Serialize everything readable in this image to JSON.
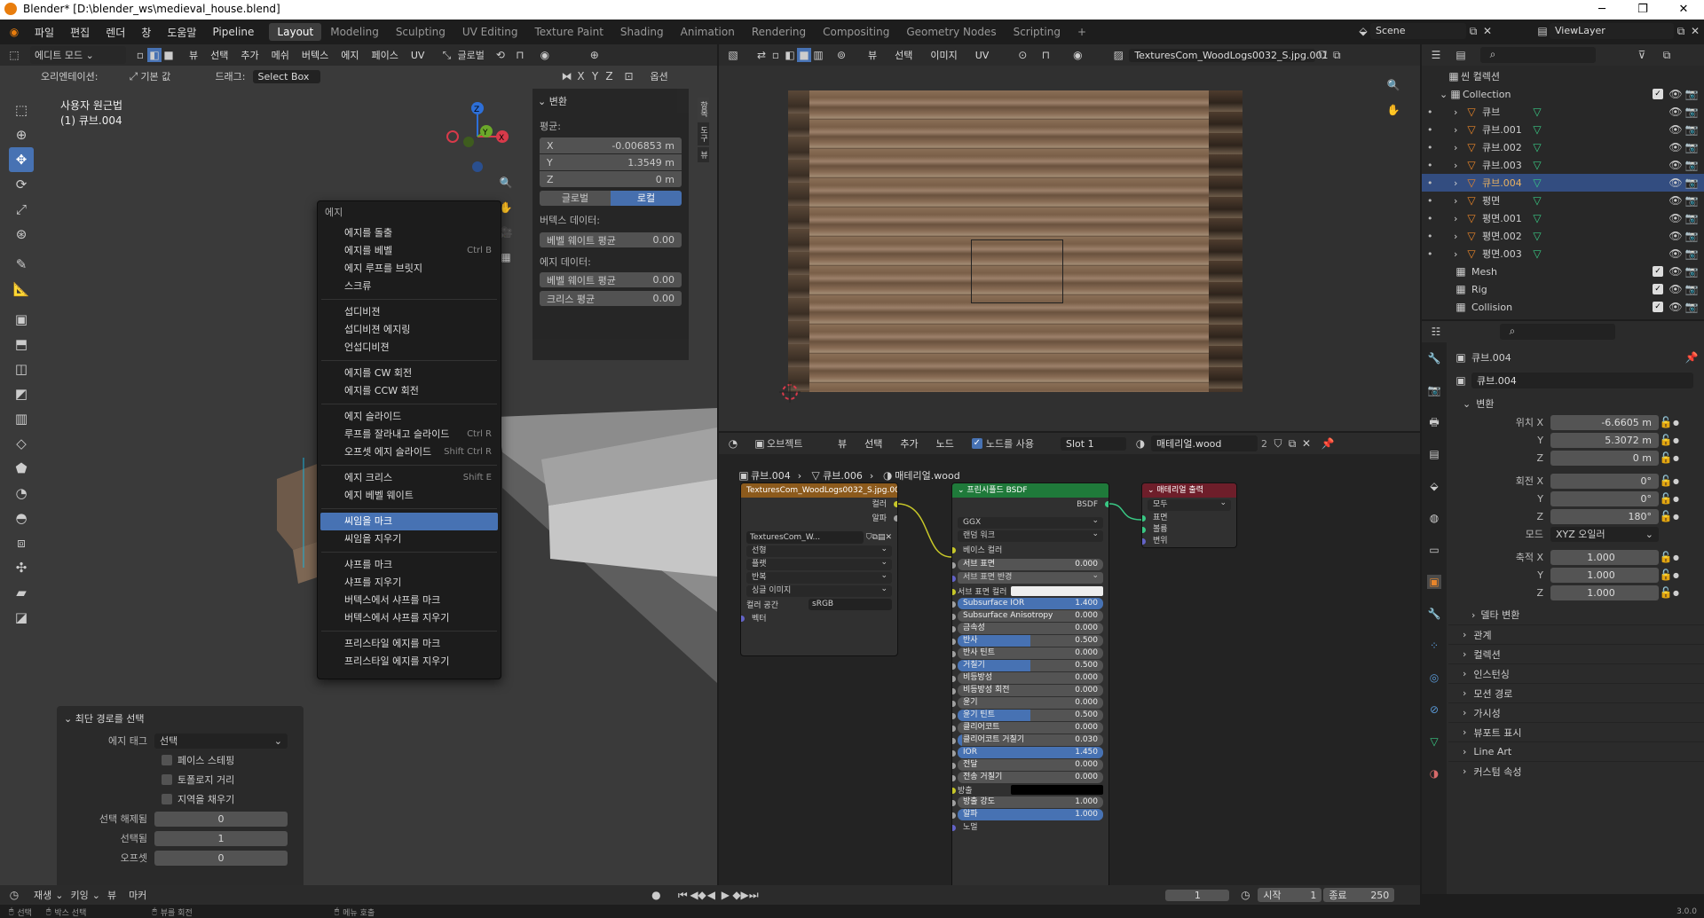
{
  "window": {
    "title": "Blender* [D:\\blender_ws\\medieval_house.blend]",
    "min": "─",
    "max": "❐",
    "close": "✕"
  },
  "menus": [
    "파일",
    "편집",
    "렌더",
    "창",
    "도움말",
    "Pipeline"
  ],
  "workspaces": [
    "Layout",
    "Modeling",
    "Sculpting",
    "UV Editing",
    "Texture Paint",
    "Shading",
    "Animation",
    "Rendering",
    "Compositing",
    "Geometry Nodes",
    "Scripting",
    "+"
  ],
  "scene": {
    "name": "Scene",
    "view_layer": "ViewLayer"
  },
  "viewport3d": {
    "mode": "에디트 모드",
    "menu": [
      "뷰",
      "선택",
      "추가",
      "메쉬",
      "버텍스",
      "에지",
      "페이스",
      "UV"
    ],
    "orientation_label": "오리엔테이션:",
    "orientation_value": "기본 값",
    "drag_label": "드래그:",
    "drag_value": "Select Box",
    "transform_orient": "글로벌",
    "options": "옵션",
    "overlay_title": "사용자 원근법",
    "overlay_obj": "(1) 큐브.004",
    "axes": {
      "x": "X",
      "y": "Y",
      "z": "Z"
    }
  },
  "npanel": {
    "header": "변환",
    "median": "평균:",
    "x_label": "X",
    "x": "-0.006853 m",
    "y_label": "Y",
    "y": "1.3549 m",
    "z_label": "Z",
    "z": "0 m",
    "global": "글로벌",
    "local": "로컬",
    "vertex_data": "버텍스 데이터:",
    "bevel_weight_v": "베벨 웨이트 평균",
    "bevel_weight_v_val": "0.00",
    "edge_data": "에지 데이터:",
    "bevel_weight_e": "베벨 웨이트 평균",
    "bevel_weight_e_val": "0.00",
    "crease": "크리스 평균",
    "crease_val": "0.00",
    "tabs": [
      "항목",
      "도구",
      "뷰"
    ]
  },
  "context_menu": {
    "title": "에지",
    "groups": [
      [
        {
          "l": "에지를 돌출",
          "s": ""
        },
        {
          "l": "에지를 베벨",
          "s": "Ctrl B"
        },
        {
          "l": "에지 루프를 브릿지",
          "s": ""
        },
        {
          "l": "스크류",
          "s": ""
        }
      ],
      [
        {
          "l": "섭디비젼",
          "s": ""
        },
        {
          "l": "섭디비젼 에지링",
          "s": ""
        },
        {
          "l": "언섭디비젼",
          "s": ""
        }
      ],
      [
        {
          "l": "에지를 CW 회전",
          "s": ""
        },
        {
          "l": "에지를 CCW 회전",
          "s": ""
        }
      ],
      [
        {
          "l": "에지 슬라이드",
          "s": ""
        },
        {
          "l": "루프를 잘라내고 슬라이드",
          "s": "Ctrl R"
        },
        {
          "l": "오프셋 에지 슬라이드",
          "s": "Shift Ctrl R"
        }
      ],
      [
        {
          "l": "에지 크리스",
          "s": "Shift E"
        },
        {
          "l": "에지 베벨 웨이트",
          "s": ""
        }
      ],
      [
        {
          "l": "씨임을 마크",
          "s": "",
          "sel": true
        },
        {
          "l": "씨임을 지우기",
          "s": ""
        }
      ],
      [
        {
          "l": "샤프를 마크",
          "s": ""
        },
        {
          "l": "샤프를 지우기",
          "s": ""
        },
        {
          "l": "버텍스에서 샤프를 마크",
          "s": ""
        },
        {
          "l": "버텍스에서 샤프를 지우기",
          "s": ""
        }
      ],
      [
        {
          "l": "프리스타일 에지를 마크",
          "s": ""
        },
        {
          "l": "프리스타일 에지를 지우기",
          "s": ""
        }
      ]
    ]
  },
  "operator_panel": {
    "title": "최단 경로를 선택",
    "edge_tag_label": "에지 태그",
    "edge_tag": "선택",
    "face_stepping": "페이스 스테핑",
    "topology_distance": "토폴로지 거리",
    "fill_region": "지역을 채우기",
    "deselected_label": "선택 해제됨",
    "deselected": "0",
    "selected_label": "선택됨",
    "selected": "1",
    "offset_label": "오프셋",
    "offset": "0"
  },
  "timeline": {
    "playback": "재생",
    "keying": "키잉",
    "view": "뷰",
    "marker": "마커",
    "current": "1",
    "start_label": "시작",
    "start": "1",
    "end_label": "종료",
    "end": "250"
  },
  "statusbar": {
    "a": "선택",
    "b": "박스 선택",
    "c": "뷰를 회전",
    "d": "메뉴 호출",
    "version": "3.0.0"
  },
  "image_editor": {
    "menu": [
      "뷰",
      "선택",
      "이미지",
      "UV"
    ],
    "image": "TexturesCom_WoodLogs0032_S.jpg.001"
  },
  "node_editor": {
    "type": "오브젝트",
    "menu": [
      "뷰",
      "선택",
      "추가",
      "노드"
    ],
    "use_nodes": "노드를 사용",
    "slot": "Slot 1",
    "material": "매테리얼.wood",
    "users": "2",
    "breadcrumb": [
      "큐브.004",
      "큐브.006",
      "매테리얼.wood"
    ],
    "tex_node": {
      "title": "TexturesCom_WoodLogs0032_S.jpg.00",
      "out_color": "컬러",
      "out_alpha": "알파",
      "img": "TexturesCom_W...",
      "interp": "선형",
      "proj": "플랫",
      "ext": "반복",
      "src": "싱글 이미지",
      "cs_label": "컬러 공간",
      "cs": "sRGB",
      "vector": "벡터"
    },
    "bsdf": {
      "title": "프린시플드 BSDF",
      "out": "BSDF",
      "dist": "GGX",
      "sss": "랜덤 워크",
      "base_color": "베이스 컬러",
      "sliders": [
        {
          "l": "서브 표면",
          "v": "0.000",
          "f": 0
        },
        {
          "l": "서브 표면 반경",
          "v": "",
          "f": 0,
          "dd": true
        },
        {
          "l": "서브 표면 컬러",
          "v": "",
          "f": 0,
          "white": true
        },
        {
          "l": "Subsurface IOR",
          "v": "1.400",
          "f": 1
        },
        {
          "l": "Subsurface Anisotropy",
          "v": "0.000",
          "f": 0
        },
        {
          "l": "금속성",
          "v": "0.000",
          "f": 0
        },
        {
          "l": "반사",
          "v": "0.500",
          "f": 0.5
        },
        {
          "l": "반사 틴트",
          "v": "0.000",
          "f": 0
        },
        {
          "l": "거칠기",
          "v": "0.500",
          "f": 0.5
        },
        {
          "l": "비등방성",
          "v": "0.000",
          "f": 0
        },
        {
          "l": "비등방성 회전",
          "v": "0.000",
          "f": 0
        },
        {
          "l": "윤기",
          "v": "0.000",
          "f": 0
        },
        {
          "l": "윤기 틴트",
          "v": "0.500",
          "f": 0.5
        },
        {
          "l": "클리어코트",
          "v": "0.000",
          "f": 0
        },
        {
          "l": "클리어코트 거칠기",
          "v": "0.030",
          "f": 0.03
        },
        {
          "l": "IOR",
          "v": "1.450",
          "f": 1
        },
        {
          "l": "전달",
          "v": "0.000",
          "f": 0
        },
        {
          "l": "전송 거칠기",
          "v": "0.000",
          "f": 0
        },
        {
          "l": "방출",
          "v": "",
          "f": 0,
          "black": true
        },
        {
          "l": "방출 강도",
          "v": "1.000",
          "f": 0
        },
        {
          "l": "알파",
          "v": "1.000",
          "f": 1
        },
        {
          "l": "노멀",
          "v": "",
          "f": 0,
          "plain": true
        }
      ]
    },
    "output": {
      "title": "매테리얼 출력",
      "target": "모두",
      "surface": "표면",
      "volume": "볼륨",
      "disp": "변위"
    }
  },
  "outliner": {
    "root": "씬 컬렉션",
    "collection": "Collection",
    "items": [
      "큐브",
      "큐브.001",
      "큐브.002",
      "큐브.003",
      "큐브.004",
      "평면",
      "평면.001",
      "평면.002",
      "평면.003"
    ],
    "active_index": 4,
    "other": [
      "Mesh",
      "Rig",
      "Collision"
    ]
  },
  "properties": {
    "object_name": "큐브.004",
    "data_name": "큐브.004",
    "transform": "변환",
    "loc_label": "위치 X",
    "loc_x": "-6.6605 m",
    "loc_y": "5.3072 m",
    "loc_z": "0 m",
    "rot_label": "회전 X",
    "rot_x": "0°",
    "rot_y": "0°",
    "rot_z": "180°",
    "mode_label": "모드",
    "mode": "XYZ 오일러",
    "scale_label": "축적 X",
    "scale_x": "1.000",
    "scale_y": "1.000",
    "scale_z": "1.000",
    "y": "Y",
    "z": "Z",
    "delta": "델타 변환",
    "sections": [
      "관계",
      "컬렉션",
      "인스턴싱",
      "모션 경로",
      "가시성",
      "뷰포트 표시",
      "Line Art",
      "커스텀 속성"
    ]
  }
}
